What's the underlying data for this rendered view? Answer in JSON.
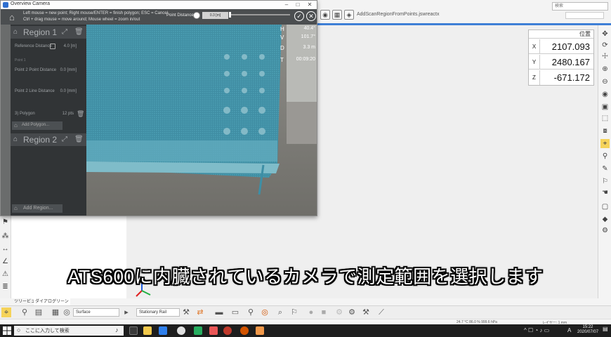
{
  "app": {
    "title": "AddScanRegionFromPoints.jswreactx",
    "search_placeholder": "検索"
  },
  "coords": {
    "header": "位置",
    "rows": [
      {
        "axis": "X",
        "value": "2107.093"
      },
      {
        "axis": "Y",
        "value": "2480.167"
      },
      {
        "axis": "Z",
        "value": "-671.172"
      }
    ]
  },
  "camera": {
    "title": "Overview Camera",
    "hint1": "Left mouse = new point; Right mouse/ENTER = finish polygon; ESC = Cancel",
    "hint2": "Ctrl + drag mouse = move around; Mouse wheel = zoom in/out",
    "point_distance_label": "Point Distance",
    "point_distance_value": "0.3 [m]",
    "telemetry": [
      {
        "label": "H",
        "value": "40.4°"
      },
      {
        "label": "V",
        "value": "101.7°"
      },
      {
        "label": "D",
        "value": "3.3 m"
      },
      {
        "label": "T",
        "value": "00:09:20"
      }
    ]
  },
  "regions": {
    "region1": {
      "title": "Region 1",
      "reference_distance_label": "Reference Distance",
      "reference_distance_value": "4.0 [m]",
      "point1_label": "Point 1",
      "point2_label": "Point 2 Point Distance",
      "point2_value": "0.0 [mm]",
      "line_distance_label": "Point 2 Line Distance",
      "line_distance_value": "0.0 [mm]",
      "polygon_label": "3) Polygon",
      "polygon_value": "12 pts",
      "add_polygon_label": "Add Polygon..."
    },
    "region2": {
      "title": "Region 2"
    },
    "add_region_label": "Add Region..."
  },
  "subtitle": "ATS600に内臓されているカメラで測定範囲を選択します",
  "tabs": [
    "ツリービュー",
    "ダイアログリーン"
  ],
  "bottom_toolbar": {
    "surface_combo": "Surface",
    "rail_combo": "Stationary Rail"
  },
  "status": {
    "info": "24.7 °C  86.0 %  999.6 hPa",
    "right": "レイヤー: 1   mm"
  },
  "taskbar": {
    "search_placeholder": "ここに入力して検索",
    "time": "15:22",
    "date": "2020/07/07",
    "ime": "A"
  }
}
